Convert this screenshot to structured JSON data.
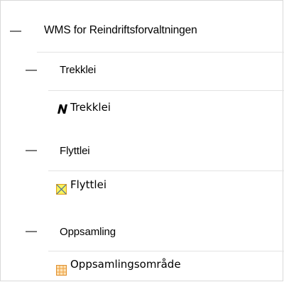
{
  "layer_tree": {
    "root": {
      "label": "WMS for Reindriftsforvaltningen"
    },
    "groups": [
      {
        "label": "Trekklei",
        "legend": {
          "label": "Trekklei",
          "icon": "trekklei-symbol-icon",
          "color": "#000000"
        }
      },
      {
        "label": "Flyttlei",
        "legend": {
          "label": "Flyttlei",
          "icon": "flyttlei-symbol-icon",
          "color": "#e8e800"
        }
      },
      {
        "label": "Oppsamling",
        "legend": {
          "label": "Oppsamlingsområde",
          "icon": "oppsamlingsomrade-symbol-icon",
          "color": "#f0a020"
        }
      }
    ]
  }
}
